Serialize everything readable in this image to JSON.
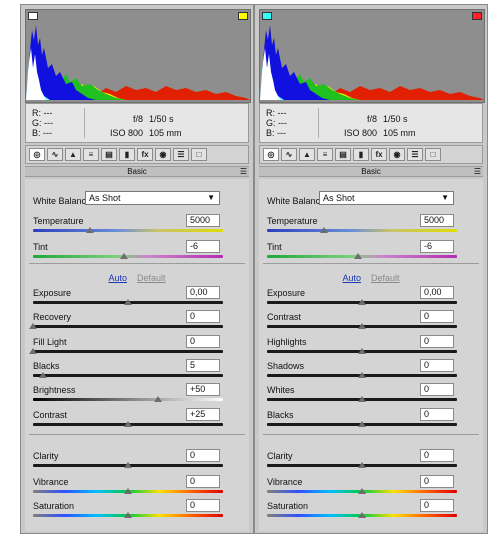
{
  "panels": [
    {
      "id": "left",
      "clip_left_color": "#ffffff",
      "clip_right_color": "#ffff00",
      "info": {
        "r": "R:",
        "g": "G:",
        "b": "B:",
        "r_val": "---",
        "g_val": "---",
        "b_val": "---",
        "aperture": "f/8",
        "shutter": "1/50 s",
        "iso": "ISO 800",
        "focal": "105 mm"
      },
      "toolbar_icons": [
        "basic-icon",
        "tone-curve-icon",
        "detail-icon",
        "hsl-icon",
        "split-toning-icon",
        "lens-corrections-icon",
        "effects-icon",
        "camera-calibration-icon",
        "presets-icon",
        "snapshots-icon"
      ],
      "section_title": "Basic",
      "menu_label": "☰",
      "white_balance_label": "White Balance:",
      "white_balance_value": "As Shot",
      "auto_label": "Auto",
      "default_label": "Default",
      "controls": [
        {
          "label": "Temperature",
          "value": "5000",
          "pos": 0.3,
          "track": "temp"
        },
        {
          "label": "Tint",
          "value": "-6",
          "pos": 0.48,
          "track": "tint"
        },
        {
          "label": "Exposure",
          "value": "0,00",
          "pos": 0.5,
          "track": "dark"
        },
        {
          "label": "Recovery",
          "value": "0",
          "pos": 0.0,
          "track": "dark"
        },
        {
          "label": "Fill Light",
          "value": "0",
          "pos": 0.0,
          "track": "dark"
        },
        {
          "label": "Blacks",
          "value": "5",
          "pos": 0.05,
          "track": "dark"
        },
        {
          "label": "Brightness",
          "value": "+50",
          "pos": 0.66,
          "track": "grad"
        },
        {
          "label": "Contrast",
          "value": "+25",
          "pos": 0.5,
          "track": "dark"
        },
        {
          "label": "Clarity",
          "value": "0",
          "pos": 0.5,
          "track": "dark"
        },
        {
          "label": "Vibrance",
          "value": "0",
          "pos": 0.5,
          "track": "rainbow"
        },
        {
          "label": "Saturation",
          "value": "0",
          "pos": 0.5,
          "track": "rainbow"
        }
      ]
    },
    {
      "id": "right",
      "clip_left_color": "#33ffff",
      "clip_right_color": "#ff2020",
      "info": {
        "r": "R:",
        "g": "G:",
        "b": "B:",
        "r_val": "---",
        "g_val": "---",
        "b_val": "---",
        "aperture": "f/8",
        "shutter": "1/50 s",
        "iso": "ISO 800",
        "focal": "105 mm"
      },
      "toolbar_icons": [
        "basic-icon",
        "tone-curve-icon",
        "detail-icon",
        "hsl-icon",
        "split-toning-icon",
        "lens-corrections-icon",
        "effects-icon",
        "camera-calibration-icon",
        "presets-icon",
        "snapshots-icon"
      ],
      "section_title": "Basic",
      "menu_label": "☰",
      "white_balance_label": "White Balance:",
      "white_balance_value": "As Shot",
      "auto_label": "Auto",
      "default_label": "Default",
      "controls": [
        {
          "label": "Temperature",
          "value": "5000",
          "pos": 0.3,
          "track": "temp"
        },
        {
          "label": "Tint",
          "value": "-6",
          "pos": 0.48,
          "track": "tint"
        },
        {
          "label": "Exposure",
          "value": "0,00",
          "pos": 0.5,
          "track": "dark"
        },
        {
          "label": "Contrast",
          "value": "0",
          "pos": 0.5,
          "track": "dark"
        },
        {
          "label": "Highlights",
          "value": "0",
          "pos": 0.5,
          "track": "dark"
        },
        {
          "label": "Shadows",
          "value": "0",
          "pos": 0.5,
          "track": "dark"
        },
        {
          "label": "Whites",
          "value": "0",
          "pos": 0.5,
          "track": "dark"
        },
        {
          "label": "Blacks",
          "value": "0",
          "pos": 0.5,
          "track": "dark"
        },
        {
          "label": "Clarity",
          "value": "0",
          "pos": 0.5,
          "track": "dark"
        },
        {
          "label": "Vibrance",
          "value": "0",
          "pos": 0.5,
          "track": "rainbow"
        },
        {
          "label": "Saturation",
          "value": "0",
          "pos": 0.5,
          "track": "rainbow"
        }
      ]
    }
  ],
  "colors": {
    "histogram_bg": "#8e8e8e",
    "panel_bg": "#c9c9c9",
    "link_blue": "#1c39b5"
  }
}
